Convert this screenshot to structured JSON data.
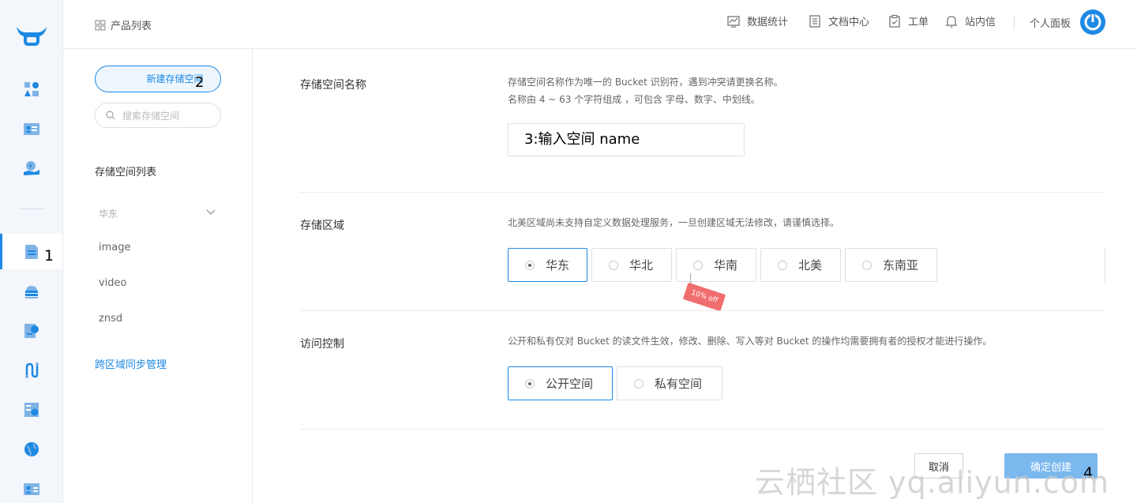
{
  "topbar": {
    "product_list": "产品列表",
    "nav": [
      "数据统计",
      "文档中心",
      "工单",
      "站内信"
    ],
    "personal_panel": "个人面板"
  },
  "rail": {
    "step_marker": "1",
    "brand_color": "#1d89e4"
  },
  "sidebar": {
    "new_bucket_button": "新建存储空间",
    "step_marker": "2",
    "search_placeholder": "搜索存储空间",
    "list_title": "存储空间列表",
    "region_group": "华东",
    "buckets": [
      "image",
      "video",
      "znsd"
    ],
    "cross_region_link": "跨区域同步管理"
  },
  "form": {
    "name_section": {
      "label": "存储空间名称",
      "desc_line1": "存储空间名称作为唯一的 Bucket 识别符，遇到冲突请更换名称。",
      "desc_line2": "名称由 4 ~ 63 个字符组成 ，可包含 字母、数字、中划线。",
      "input_value": "3:输入空间 name"
    },
    "region_section": {
      "label": "存储区域",
      "desc": "北美区域尚未支持自定义数据处理服务，一旦创建区域无法修改，请谨慎选择。",
      "options": [
        "华东",
        "华北",
        "华南",
        "北美",
        "东南亚"
      ],
      "selected": "华东",
      "discount_tag": "10% off"
    },
    "access_section": {
      "label": "访问控制",
      "desc": "公开和私有仅对 Bucket 的读文件生效，修改、删除、写入等对 Bucket 的操作均需要拥有者的授权才能进行操作。",
      "options": [
        "公开空间",
        "私有空间"
      ],
      "selected": "公开空间"
    },
    "cancel_button": "取消",
    "confirm_button": "确定创建",
    "step_marker": "4"
  },
  "watermark": "云栖社区 yq.aliyun.com"
}
